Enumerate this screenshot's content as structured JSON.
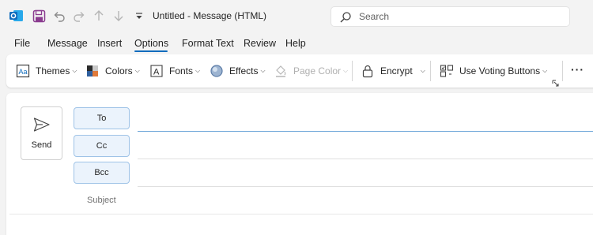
{
  "titlebar": {
    "title": "Untitled  -  Message (HTML)",
    "icons": [
      "outlook-icon",
      "save-icon",
      "undo-icon",
      "redo-icon",
      "up-arrow-icon",
      "down-arrow-icon",
      "customize-qat-icon"
    ],
    "search_placeholder": "Search"
  },
  "menu": {
    "items": [
      "File",
      "Message",
      "Insert",
      "Options",
      "Format Text",
      "Review",
      "Help"
    ],
    "active": "Options"
  },
  "ribbon": {
    "themes": "Themes",
    "colors": "Colors",
    "fonts": "Fonts",
    "effects": "Effects",
    "page_color": "Page Color",
    "encrypt": "Encrypt",
    "voting": "Use Voting Buttons",
    "more": "···"
  },
  "compose": {
    "send": "Send",
    "to": "To",
    "cc": "Cc",
    "bcc": "Bcc",
    "subject": "Subject"
  },
  "colors": {
    "accent": "#0f6cbd",
    "recipient_bg": "#ebf3fc",
    "outlook_blue": "#0f6cbd",
    "save_purple": "#8a3b8f"
  }
}
